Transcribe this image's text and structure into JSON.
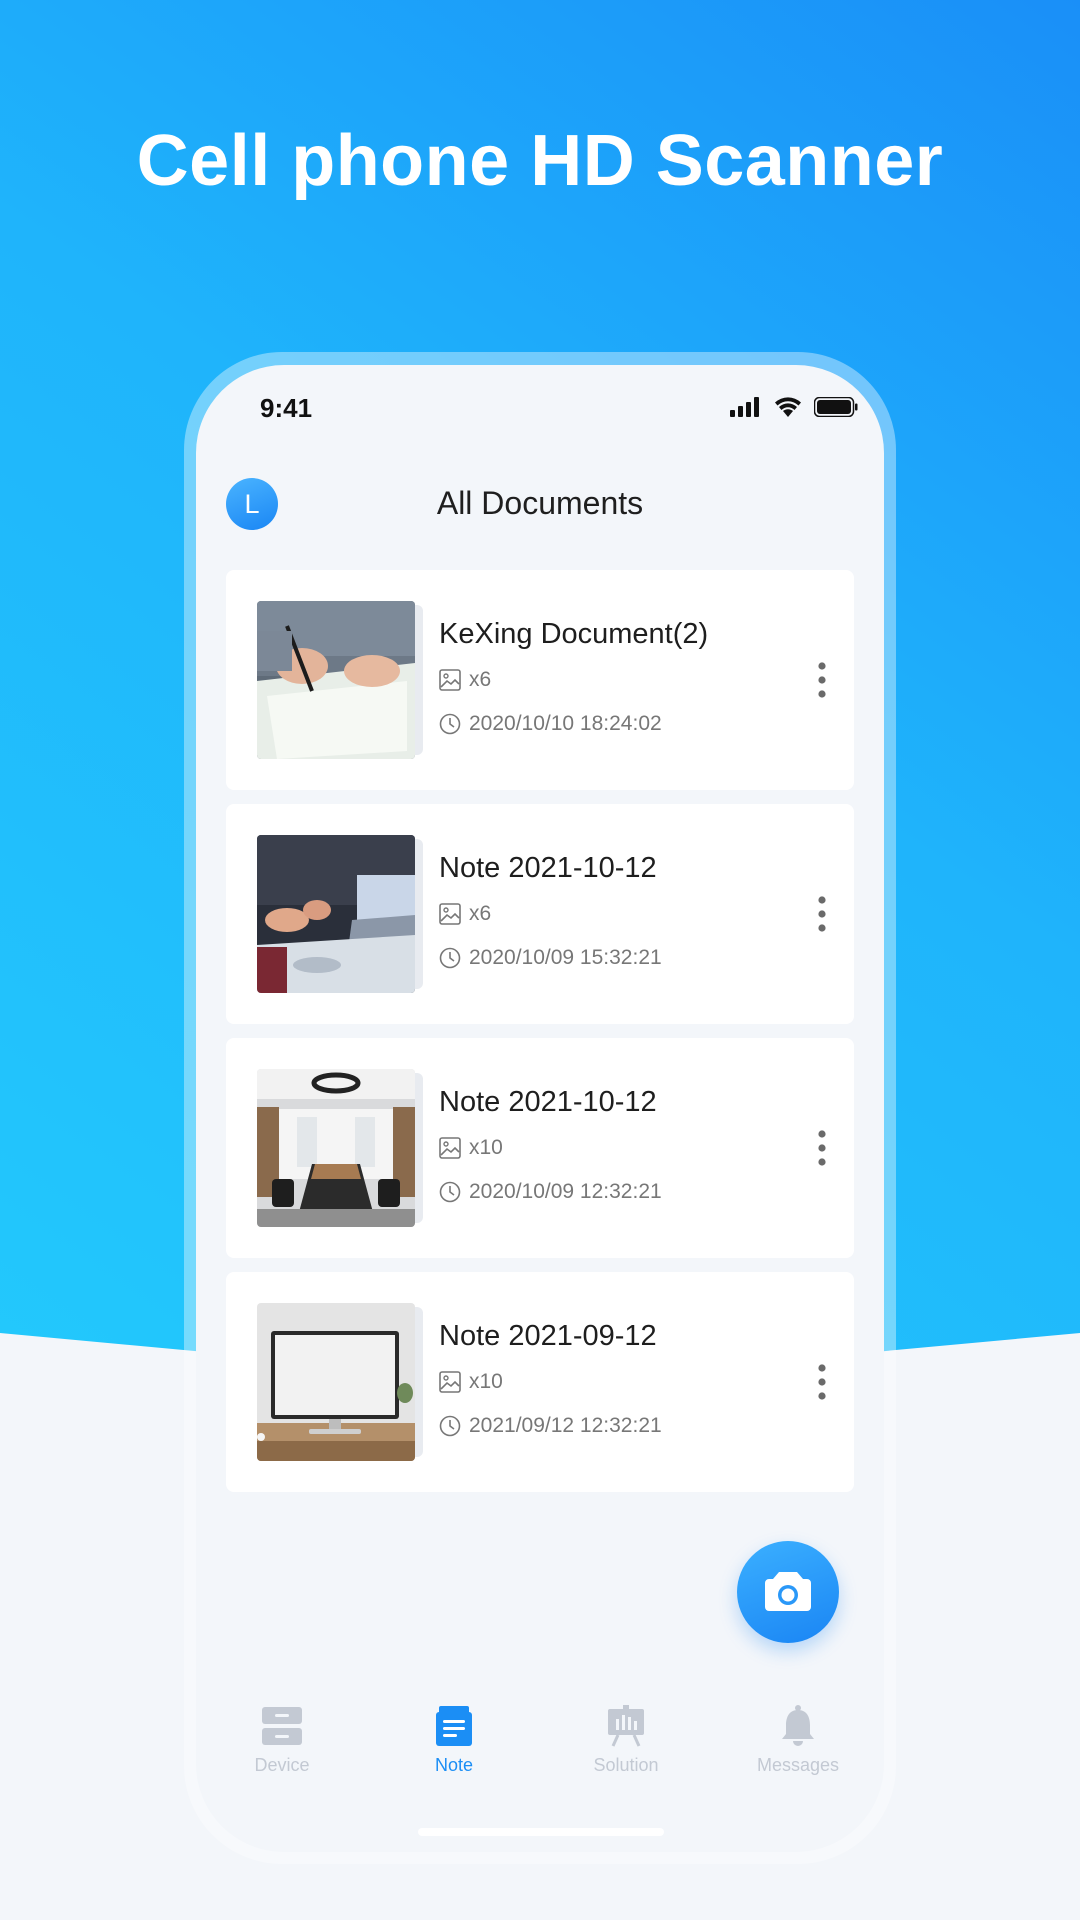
{
  "headline": "Cell phone HD Scanner",
  "status_bar": {
    "time": "9:41"
  },
  "header": {
    "avatar_letter": "L",
    "title": "All Documents"
  },
  "documents": [
    {
      "title": "KeXing Document(2)",
      "count": "x6",
      "date": "2020/10/10 18:24:02",
      "thumb": "writing-hands-photo"
    },
    {
      "title": "Note 2021-10-12",
      "count": "x6",
      "date": "2020/10/09 15:32:21",
      "thumb": "meeting-laptop-photo"
    },
    {
      "title": "Note 2021-10-12",
      "count": "x10",
      "date": "2020/10/09 12:32:21",
      "thumb": "conference-room-photo"
    },
    {
      "title": "Note 2021-09-12",
      "count": "x10",
      "date": "2021/09/12 12:32:21",
      "thumb": "desktop-monitor-photo"
    }
  ],
  "fab": {
    "icon": "camera-icon"
  },
  "tabs": [
    {
      "label": "Device",
      "icon": "device-icon",
      "active": false
    },
    {
      "label": "Note",
      "icon": "note-icon",
      "active": true
    },
    {
      "label": "Solution",
      "icon": "solution-icon",
      "active": false
    },
    {
      "label": "Messages",
      "icon": "bell-icon",
      "active": false
    }
  ],
  "colors": {
    "accent": "#1b8ef5",
    "background": "#f3f6fa",
    "gradient_top": "#1a8ff8",
    "gradient_bottom": "#23c9fc",
    "tab_inactive": "#c3c9d3"
  }
}
